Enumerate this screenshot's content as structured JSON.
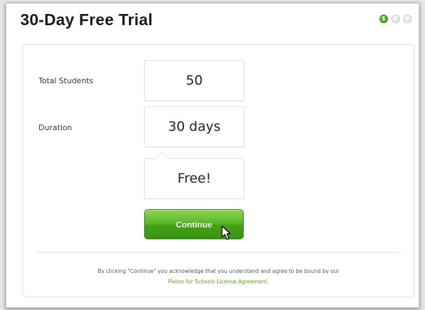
{
  "dialog": {
    "title": "30-Day Free Trial",
    "steps": [
      {
        "label": "1",
        "active": true
      },
      {
        "label": "",
        "active": false
      },
      {
        "label": "",
        "active": false
      }
    ]
  },
  "form": {
    "total_students_label": "Total Students",
    "total_students_value": "50",
    "duration_label": "Duration",
    "duration_value": "30 days",
    "price_value": "Free!"
  },
  "actions": {
    "continue_label": "Continue"
  },
  "footer": {
    "agreement_text": "By clicking \"Continue\" you acknowledge that you understand and agree to be bound by our",
    "license_link": "Pixton for Schools License Agreement",
    "period": "."
  },
  "colors": {
    "accent_green": "#4aa81a",
    "link_green": "#5aa41e"
  },
  "icons": {
    "active_step": "step-number-circle",
    "cursor": "mouse-pointer-icon"
  }
}
